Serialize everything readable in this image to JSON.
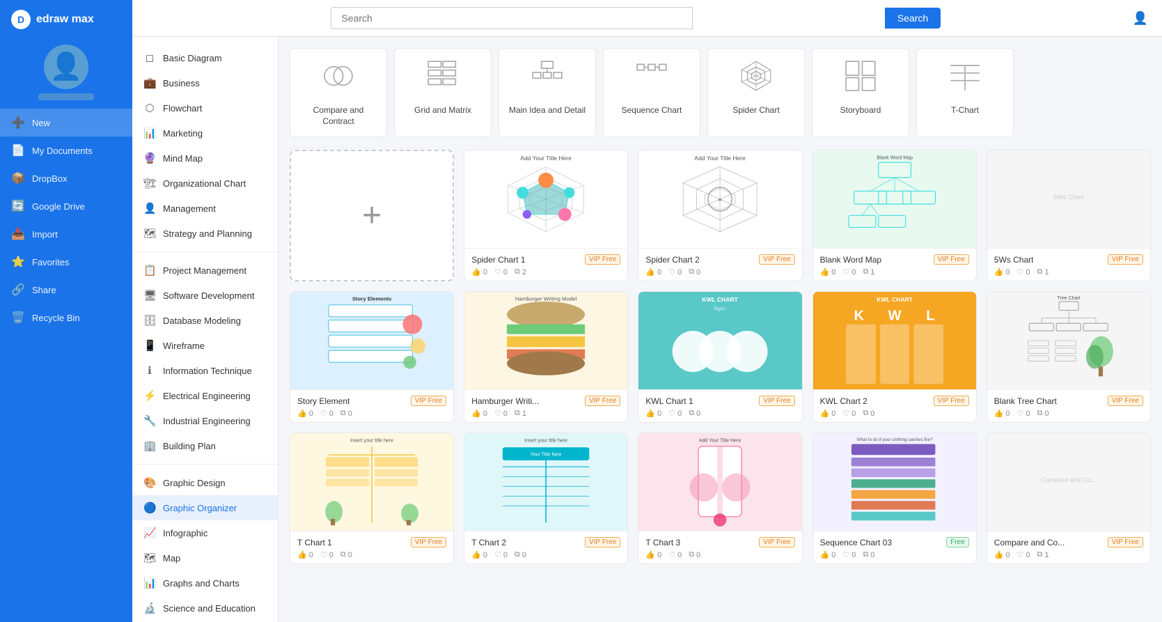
{
  "app": {
    "name": "edraw max",
    "logo_letter": "D"
  },
  "search": {
    "placeholder": "Search",
    "button_label": "Search"
  },
  "sidebar_nav": [
    {
      "id": "new",
      "label": "New",
      "icon": "➕",
      "active": true
    },
    {
      "id": "my-documents",
      "label": "My Documents",
      "icon": "📄"
    },
    {
      "id": "dropbox",
      "label": "DropBox",
      "icon": "📦"
    },
    {
      "id": "google-drive",
      "label": "Google Drive",
      "icon": "🔄"
    },
    {
      "id": "import",
      "label": "Import",
      "icon": "📥"
    },
    {
      "id": "favorites",
      "label": "Favorites",
      "icon": "⭐"
    },
    {
      "id": "share",
      "label": "Share",
      "icon": "🔗"
    },
    {
      "id": "recycle-bin",
      "label": "Recycle Bin",
      "icon": "🗑️"
    }
  ],
  "left_nav": [
    {
      "id": "basic-diagram",
      "label": "Basic Diagram",
      "icon": "◻",
      "active": false
    },
    {
      "id": "business",
      "label": "Business",
      "icon": "💼",
      "active": false
    },
    {
      "id": "flowchart",
      "label": "Flowchart",
      "icon": "⬡",
      "active": false
    },
    {
      "id": "marketing",
      "label": "Marketing",
      "icon": "📊",
      "active": false
    },
    {
      "id": "mind-map",
      "label": "Mind Map",
      "icon": "🔮",
      "active": false
    },
    {
      "id": "org-chart",
      "label": "Organizational Chart",
      "icon": "🏗",
      "active": false
    },
    {
      "id": "management",
      "label": "Management",
      "icon": "👤",
      "active": false
    },
    {
      "id": "strategy",
      "label": "Strategy and Planning",
      "icon": "🗺",
      "active": false
    },
    {
      "divider": true
    },
    {
      "id": "project-mgmt",
      "label": "Project Management",
      "icon": "📋",
      "active": false
    },
    {
      "id": "software-dev",
      "label": "Software Development",
      "icon": "🖥",
      "active": false
    },
    {
      "id": "database",
      "label": "Database Modeling",
      "icon": "🗄",
      "active": false
    },
    {
      "id": "wireframe",
      "label": "Wireframe",
      "icon": "📱",
      "active": false
    },
    {
      "id": "info-tech",
      "label": "Information Technique",
      "icon": "ℹ",
      "active": false
    },
    {
      "id": "electrical",
      "label": "Electrical Engineering",
      "icon": "⚡",
      "active": false
    },
    {
      "id": "industrial",
      "label": "Industrial Engineering",
      "icon": "🔧",
      "active": false
    },
    {
      "id": "building",
      "label": "Building Plan",
      "icon": "🏢",
      "active": false
    },
    {
      "divider": true
    },
    {
      "id": "graphic-design",
      "label": "Graphic Design",
      "icon": "🎨",
      "active": false
    },
    {
      "id": "graphic-organizer",
      "label": "Graphic Organizer",
      "icon": "🔵",
      "active": true
    },
    {
      "id": "infographic",
      "label": "Infographic",
      "icon": "📈",
      "active": false
    },
    {
      "id": "map",
      "label": "Map",
      "icon": "🗺",
      "active": false
    },
    {
      "id": "graphs-charts",
      "label": "Graphs and Charts",
      "icon": "📊",
      "active": false
    },
    {
      "id": "science-edu",
      "label": "Science and Education",
      "icon": "🔬",
      "active": false
    }
  ],
  "categories": [
    {
      "id": "compare",
      "label": "Compare and Contract",
      "icon": "compare"
    },
    {
      "id": "grid",
      "label": "Grid and Matrix",
      "icon": "grid"
    },
    {
      "id": "main-idea",
      "label": "Main Idea and Detail",
      "icon": "main-idea"
    },
    {
      "id": "sequence",
      "label": "Sequence Chart",
      "icon": "sequence"
    },
    {
      "id": "spider",
      "label": "Spider Chart",
      "icon": "spider"
    },
    {
      "id": "storyboard",
      "label": "Storyboard",
      "icon": "storyboard"
    },
    {
      "id": "tchart",
      "label": "T-Chart",
      "icon": "tchart"
    }
  ],
  "templates": [
    {
      "id": "add-new",
      "type": "add-new"
    },
    {
      "id": "spider1",
      "name": "Spider Chart 1",
      "badge": "VIP Free",
      "badge_type": "vip-free",
      "likes": 0,
      "hearts": 0,
      "copies": 2,
      "bg": "spider1"
    },
    {
      "id": "spider2",
      "name": "Spider Chart 2",
      "badge": "VIP Free",
      "badge_type": "vip-free",
      "likes": 0,
      "hearts": 0,
      "copies": 0,
      "bg": "spider2"
    },
    {
      "id": "blank-word",
      "name": "Blank Word Map",
      "badge": "VIP Free",
      "badge_type": "vip-free",
      "likes": 0,
      "hearts": 0,
      "copies": 1,
      "bg": "blank-word"
    },
    {
      "id": "5ws",
      "name": "5Ws Chart",
      "badge": "VIP Free",
      "badge_type": "vip-free",
      "likes": 0,
      "hearts": 0,
      "copies": 1,
      "bg": "fivews"
    },
    {
      "id": "story",
      "name": "Story Element",
      "badge": "VIP Free",
      "badge_type": "vip-free",
      "likes": 0,
      "hearts": 0,
      "copies": 0,
      "bg": "story"
    },
    {
      "id": "hamburger",
      "name": "Hamburger Writi...",
      "badge": "VIP Free",
      "badge_type": "vip-free",
      "likes": 0,
      "hearts": 0,
      "copies": 1,
      "bg": "hamburger"
    },
    {
      "id": "kwl1",
      "name": "KWL Chart 1",
      "badge": "VIP Free",
      "badge_type": "vip-free",
      "likes": 0,
      "hearts": 0,
      "copies": 0,
      "bg": "kwl1"
    },
    {
      "id": "kwl2",
      "name": "KWL Chart 2",
      "badge": "VIP Free",
      "badge_type": "vip-free",
      "likes": 0,
      "hearts": 0,
      "copies": 0,
      "bg": "kwl2"
    },
    {
      "id": "blank-tree",
      "name": "Blank Tree Chart",
      "badge": "VIP Free",
      "badge_type": "vip-free",
      "likes": 0,
      "hearts": 0,
      "copies": 0,
      "bg": "blank-tree"
    },
    {
      "id": "tchart1",
      "name": "T Chart 1",
      "badge": "VIP Free",
      "badge_type": "vip-free",
      "likes": 0,
      "hearts": 0,
      "copies": 0,
      "bg": "tchart1"
    },
    {
      "id": "tchart2",
      "name": "T Chart 2",
      "badge": "VIP Free",
      "badge_type": "vip-free",
      "likes": 0,
      "hearts": 0,
      "copies": 0,
      "bg": "tchart2"
    },
    {
      "id": "tchart3",
      "name": "T Chart 3",
      "badge": "VIP Free",
      "badge_type": "vip-free",
      "likes": 0,
      "hearts": 0,
      "copies": 0,
      "bg": "tchart3"
    },
    {
      "id": "seq03",
      "name": "Sequence Chart 03",
      "badge": "Free",
      "badge_type": "free",
      "likes": 0,
      "hearts": 0,
      "copies": 0,
      "bg": "seq03"
    },
    {
      "id": "compare-co",
      "name": "Compare and Co...",
      "badge": "VIP Free",
      "badge_type": "vip-free",
      "likes": 0,
      "hearts": 0,
      "copies": 1,
      "bg": "compare"
    }
  ]
}
